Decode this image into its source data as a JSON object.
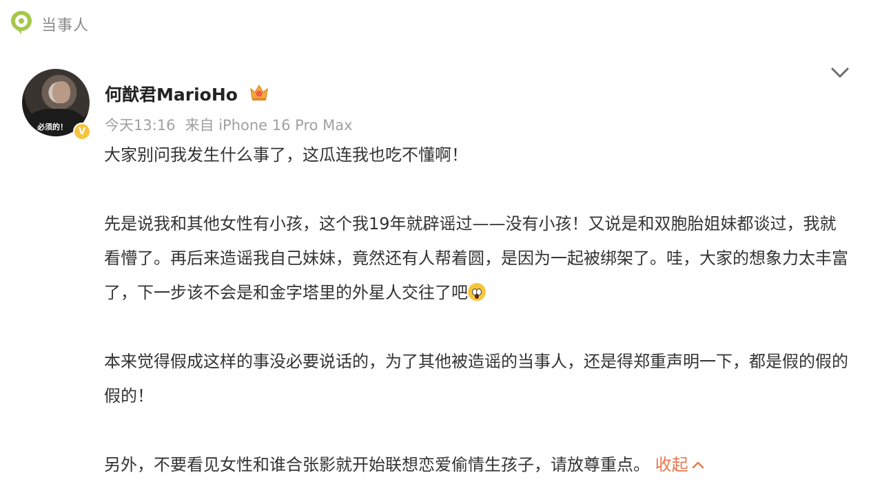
{
  "header": {
    "label": "当事人"
  },
  "post": {
    "author": "何猷君MarioHo",
    "avatar_caption": "必须的！",
    "verified_mark": "V",
    "time": "今天13:16",
    "source": "来自 iPhone 16 Pro Max",
    "paragraphs": [
      "大家别问我发生什么事了，这瓜连我也吃不懂啊！",
      "先是说我和其他女性有小孩，这个我19年就辟谣过——没有小孩！又说是和双胞胎姐妹都谈过，我就看懵了。再后来造谣我自己妹妹，竟然还有人帮着圆，是因为一起被绑架了。哇，大家的想象力太丰富了，下一步该不会是和金字塔里的外星人交往了吧",
      "本来觉得假成这样的事没必要说话的，为了其他被造谣的当事人，还是得郑重声明一下，都是假的假的假的！",
      "另外，不要看见女性和谁合张影就开始联想恋爱偷情生孩子，请放尊重点。"
    ],
    "collapse_label": "收起"
  },
  "icons": {
    "header_icon": "location-pin-icon",
    "badge_icon": "crown-badge-icon",
    "menu_icon": "chevron-down-icon",
    "emoji_icon": "scream-emoji-icon",
    "collapse_icon": "chevron-up-icon"
  },
  "colors": {
    "brand_green": "#a5c74a",
    "accent_orange": "#e8774b",
    "verified_gold": "#f6c443"
  }
}
